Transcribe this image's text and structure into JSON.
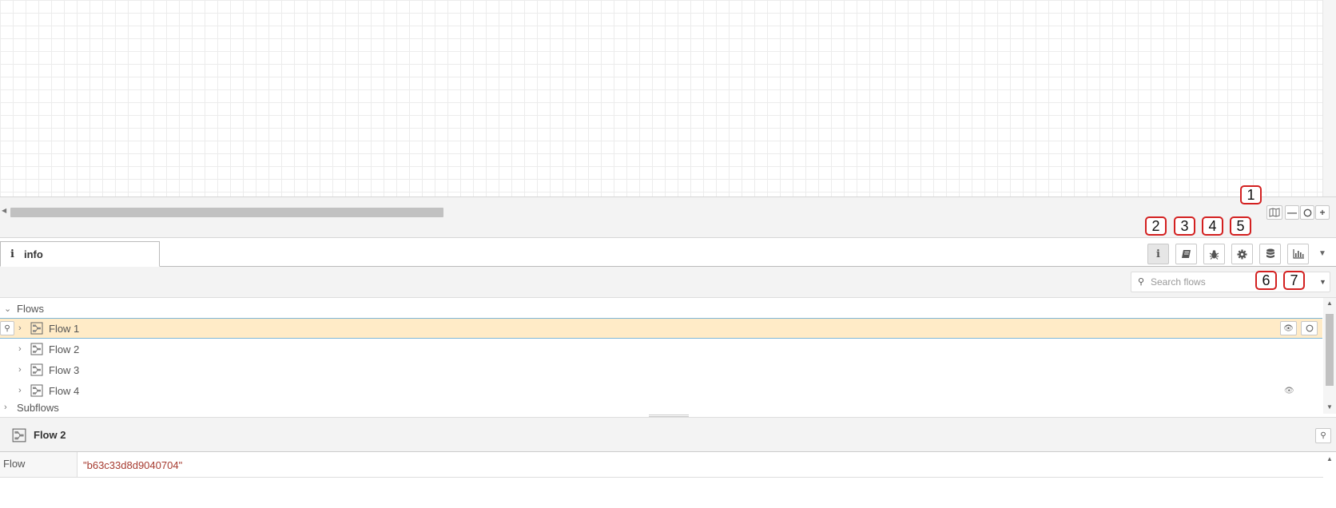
{
  "annotations": [
    "1",
    "2",
    "3",
    "4",
    "5",
    "6",
    "7"
  ],
  "workspace": {
    "navigator_icon": "map-icon",
    "zoom_out_icon": "minus-icon",
    "zoom_reset_icon": "circle-icon",
    "zoom_in_icon": "plus-icon"
  },
  "sidebar": {
    "active_tab": "info",
    "tab_icons": [
      "info-icon",
      "book-icon",
      "bug-icon",
      "gear-icon",
      "database-icon",
      "bar-chart-icon"
    ],
    "search": {
      "placeholder": "Search flows",
      "value": ""
    }
  },
  "tree": {
    "flows_label": "Flows",
    "subflows_label": "Subflows",
    "items": [
      {
        "label": "Flow 1",
        "selected": true
      },
      {
        "label": "Flow 2",
        "selected": false
      },
      {
        "label": "Flow 3",
        "selected": false
      },
      {
        "label": "Flow 4",
        "selected": false,
        "hidden": true
      }
    ]
  },
  "properties": {
    "title": "Flow 2",
    "rows": [
      {
        "key": "Flow",
        "value": "\"b63c33d8d9040704\""
      }
    ]
  },
  "colors": {
    "selected_row": "#ffebc7",
    "annotation_border": "#d32020",
    "property_value": "#a63a2f"
  }
}
